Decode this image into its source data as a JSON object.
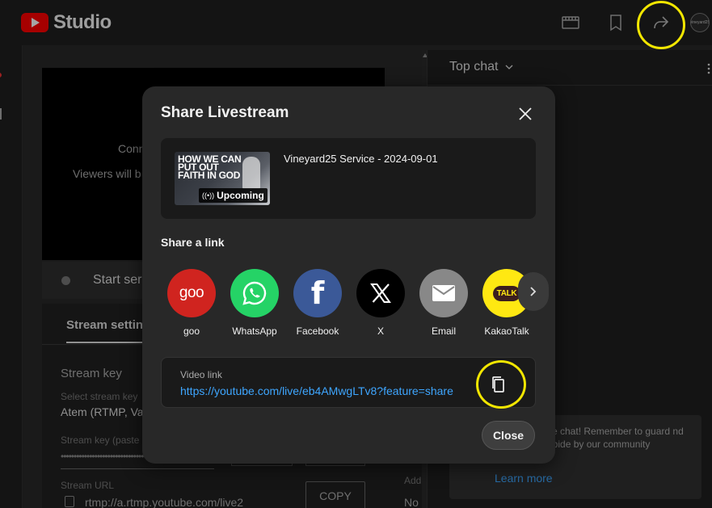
{
  "app": {
    "logo_text": "Studio",
    "channel_avatar_text": "vineyard25"
  },
  "topbar": {
    "icons": [
      "film-icon",
      "bookmark-icon",
      "share-icon",
      "avatar"
    ]
  },
  "preview": {
    "line1": "Conn",
    "line2": "Viewers will b"
  },
  "startbar": {
    "label": "Start ser"
  },
  "settings": {
    "tab_label": "Stream setting",
    "stream_key_heading": "Stream key",
    "select_label": "Select stream key",
    "select_value": "Atem (RTMP, Va",
    "key_label": "Stream key (paste",
    "key_value": "••••••••••••••••••••••••••••••••••••••••••",
    "url_label": "Stream URL",
    "url_value": "rtmp://a.rtmp.youtube.com/live2",
    "copy_label": "COPY",
    "add_text": "Add",
    "no_text": "No"
  },
  "chat": {
    "title": "Top chat",
    "card_text": "ve chat! Remember to guard nd abide by our community",
    "learn_more": "Learn more"
  },
  "dialog": {
    "title": "Share Livestream",
    "video": {
      "thumb_text": "HOW WE CAN PUT OUT FAITH IN GOD",
      "badge_icon": "((•))",
      "badge_text": "Upcoming",
      "title": "Vineyard25 Service - 2024-09-01"
    },
    "share_heading": "Share a link",
    "share_targets": [
      {
        "label": "goo",
        "icon_text": "goo"
      },
      {
        "label": "WhatsApp"
      },
      {
        "label": "Facebook",
        "icon_text": "f"
      },
      {
        "label": "X"
      },
      {
        "label": "Email"
      },
      {
        "label": "KakaoTalk",
        "icon_text": "TALK"
      }
    ],
    "link_label": "Video link",
    "link_url": "https://youtube.com/live/eb4AMwgLTv8?feature=share",
    "close_label": "Close"
  },
  "colors": {
    "accent_link": "#3ea6ff",
    "highlight": "#f2e600",
    "goo": "#d0241f",
    "whatsapp": "#25d366",
    "facebook": "#3b5998",
    "kakao": "#ffe812"
  }
}
